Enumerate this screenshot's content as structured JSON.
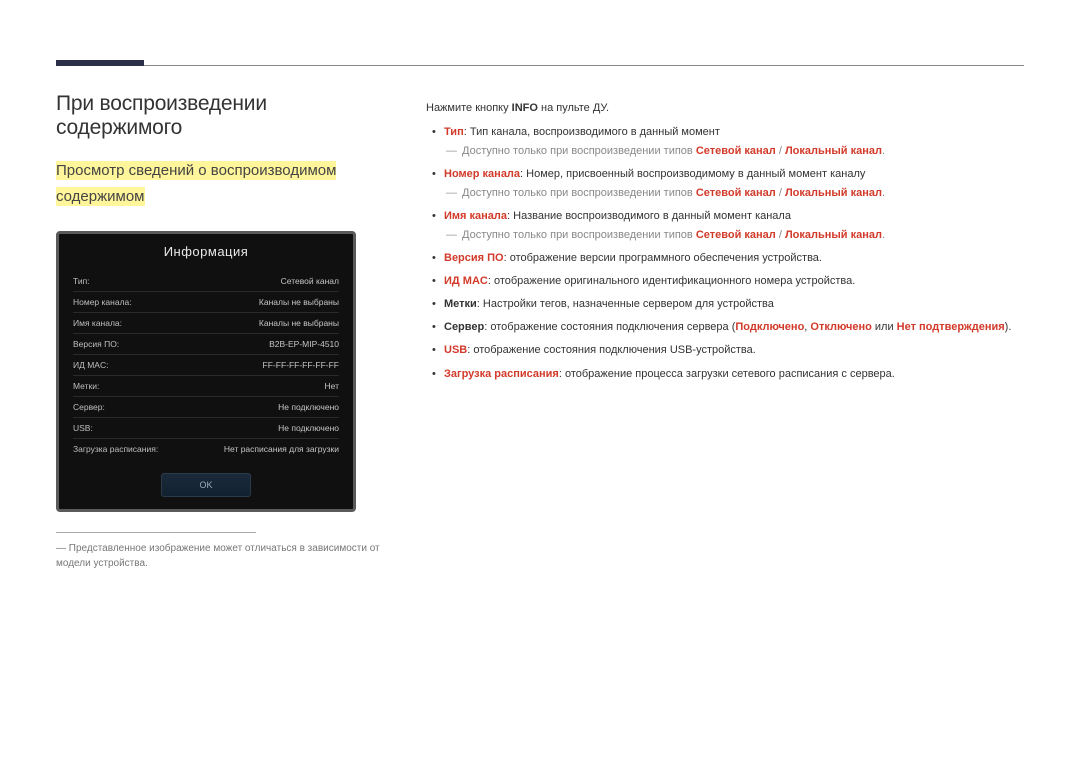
{
  "heading": "При воспроизведении содержимого",
  "subheading": "Просмотр сведений о воспроизводимом содержимом",
  "panel": {
    "title": "Информация",
    "rows": [
      {
        "k": "Тип:",
        "v": "Сетевой канал"
      },
      {
        "k": "Номер канала:",
        "v": "Каналы не выбраны"
      },
      {
        "k": "Имя канала:",
        "v": "Каналы не выбраны"
      },
      {
        "k": "Версия ПО:",
        "v": "B2B-EP-MIP-4510"
      },
      {
        "k": "ИД MAC:",
        "v": "FF-FF-FF-FF-FF-FF"
      },
      {
        "k": "Метки:",
        "v": "Нет"
      },
      {
        "k": "Сервер:",
        "v": "Не подключено"
      },
      {
        "k": "USB:",
        "v": "Не подключено"
      },
      {
        "k": "Загрузка расписания:",
        "v": "Нет расписания для загрузки"
      }
    ],
    "ok": "OK"
  },
  "footnote": "Представленное изображение может отличаться в зависимости от модели устройства.",
  "intro": {
    "pre": "Нажмите кнопку ",
    "bold": "INFO",
    "post": " на пульте ДУ."
  },
  "items": [
    {
      "label": "Тип",
      "text": ": Тип канала, воспроизводимого в данный момент",
      "sub": {
        "pre": "Доступно только при воспроизведении типов ",
        "r1": "Сетевой канал",
        "sep": " / ",
        "r2": "Локальный канал",
        "post": "."
      }
    },
    {
      "label": "Номер канала",
      "text": ": Номер, присвоенный воспроизводимому в данный момент каналу",
      "sub": {
        "pre": "Доступно только при воспроизведении типов ",
        "r1": "Сетевой канал",
        "sep": " / ",
        "r2": "Локальный канал",
        "post": "."
      }
    },
    {
      "label": "Имя канала",
      "text": ": Название воспроизводимого в данный момент канала",
      "sub": {
        "pre": "Доступно только при воспроизведении типов ",
        "r1": "Сетевой канал",
        "sep": " / ",
        "r2": "Локальный канал",
        "post": "."
      }
    },
    {
      "label": "Версия ПО",
      "text": ": отображение версии программного обеспечения устройства."
    },
    {
      "label": "ИД MAC",
      "text": ": отображение оригинального идентификационного номера устройства."
    },
    {
      "label": "Метки",
      "labelPlain": true,
      "text": ": Настройки тегов, назначенные сервером для устройства"
    },
    {
      "label": "Сервер",
      "labelPlain": true,
      "text": ": отображение состояния подключения сервера (",
      "r1": "Подключено",
      "c1": ", ",
      "r2": "Отключено",
      "c2": " или ",
      "r3": "Нет подтверждения",
      "post": ")."
    },
    {
      "label": "USB",
      "text": ": отображение состояния подключения USB-устройства."
    },
    {
      "label": "Загрузка расписания",
      "text": ": отображение процесса загрузки сетевого расписания с сервера."
    }
  ]
}
